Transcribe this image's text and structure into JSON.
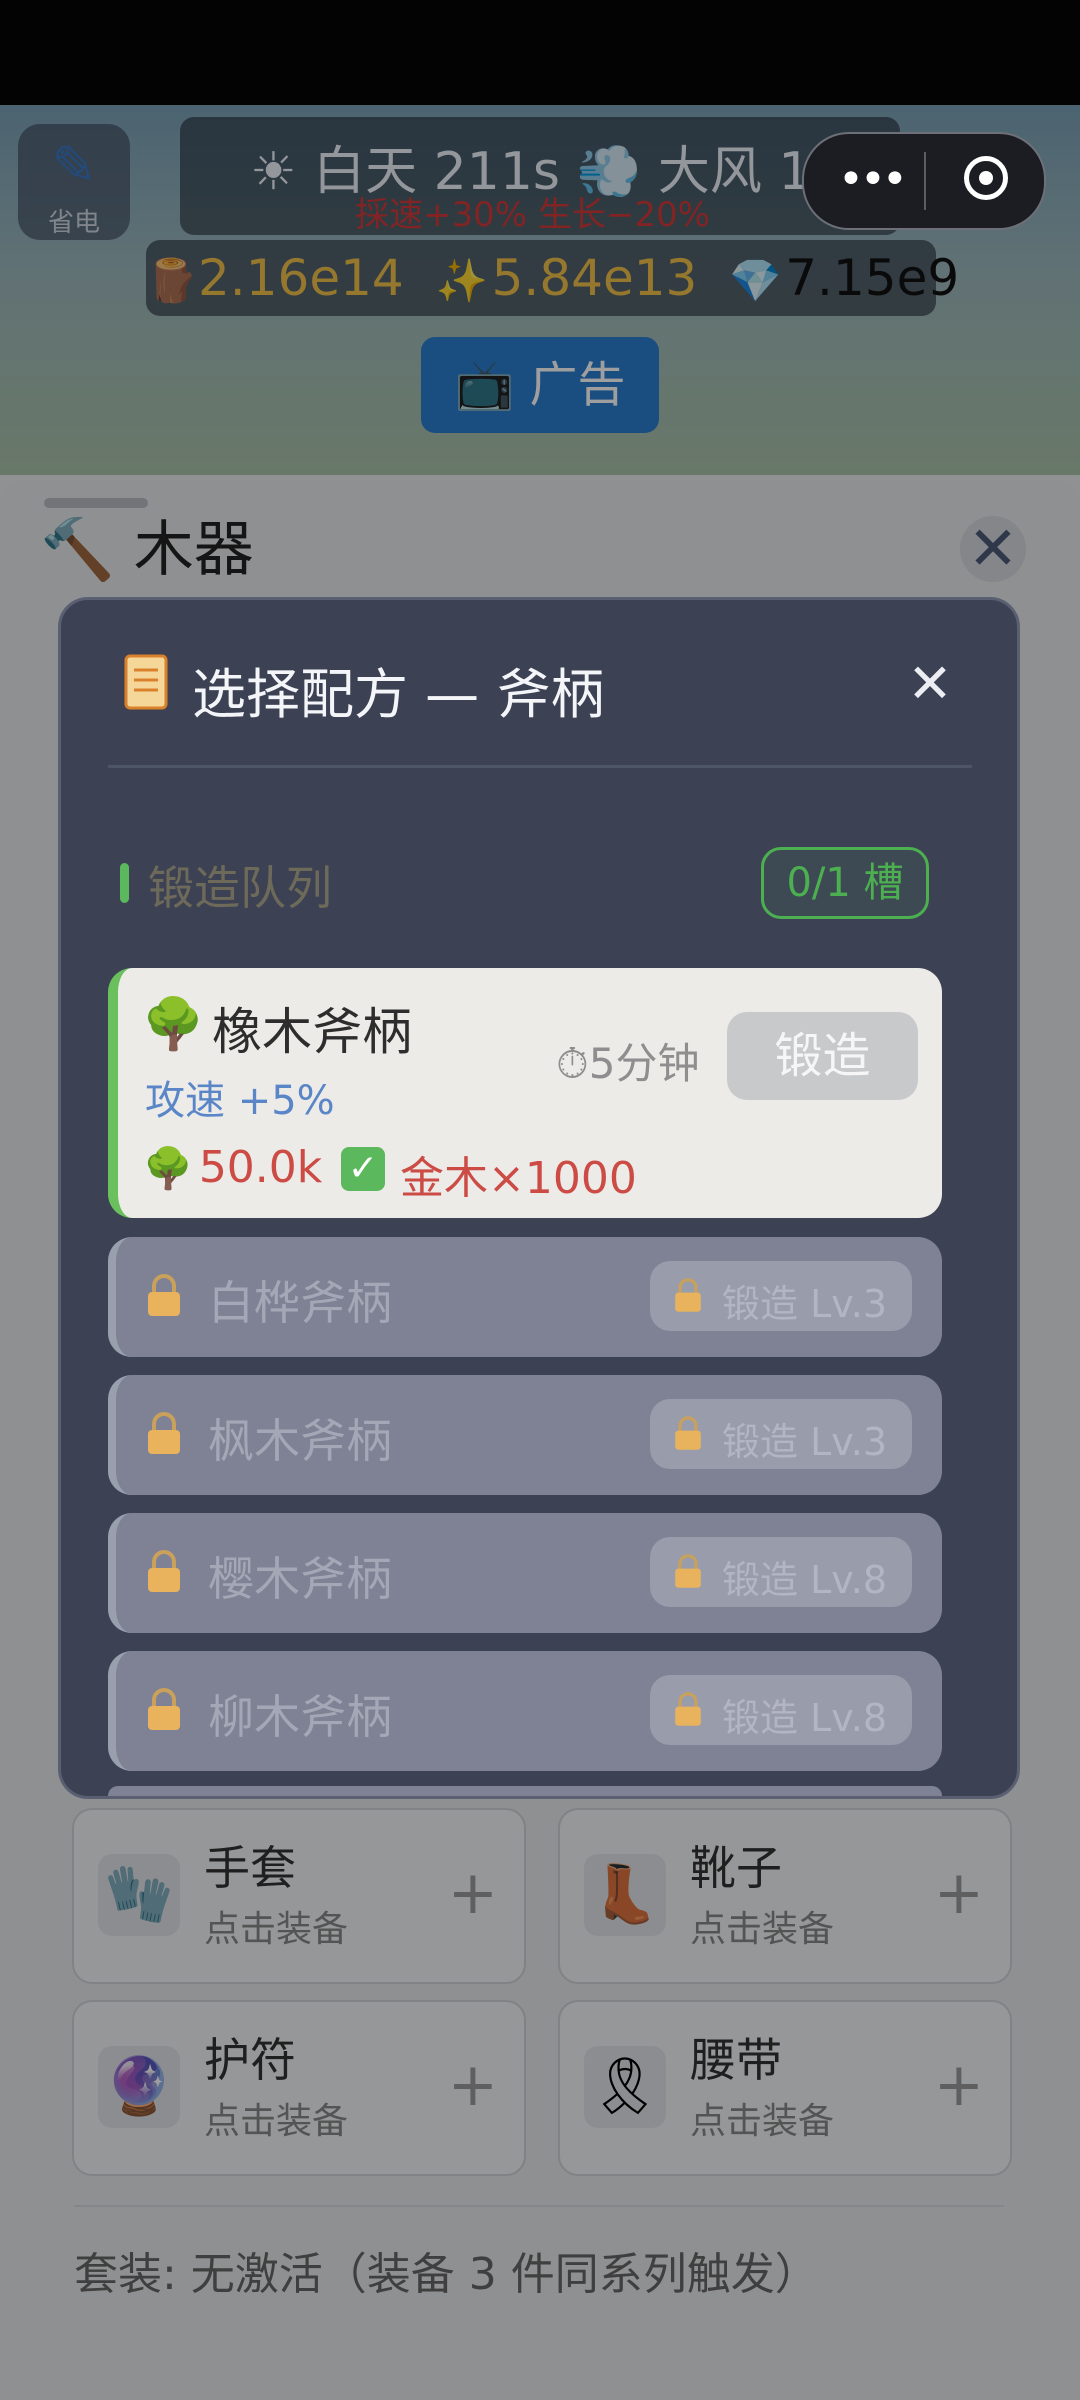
{
  "top": {
    "power_label": "省电",
    "weather_line1": "☀ 白天 211s  💨 大风 136",
    "weather_line2": "採速+30%  生长−20%",
    "resources": {
      "wood": "2.16e14",
      "spark": "5.84e13",
      "gem": "7.15e9"
    },
    "ad_label": "📺 广告"
  },
  "sheet": {
    "title": "🔨 木器",
    "close": "✕",
    "equipment": [
      {
        "name": "手套",
        "hint": "点击装备",
        "icon": "glove-icon",
        "emoji": "🧤"
      },
      {
        "name": "靴子",
        "hint": "点击装备",
        "icon": "boot-icon",
        "emoji": "👢"
      },
      {
        "name": "护符",
        "hint": "点击装备",
        "icon": "amulet-icon",
        "emoji": "🔮"
      },
      {
        "name": "腰带",
        "hint": "点击装备",
        "icon": "belt-icon",
        "emoji": "🎗"
      }
    ],
    "plus": "+",
    "set_info": "套装: 无激活（装备 3 件同系列触发）"
  },
  "modal": {
    "title": "选择配方 — 斧柄",
    "close": "✕",
    "queue_label": "锻造队列",
    "slots": "0/1 槽",
    "recipe": {
      "name": "橡木斧柄",
      "stat": "攻速 +5%",
      "time": "⏱5分钟",
      "forge_label": "锻造",
      "cost_wood": "50.0k",
      "cost_material": "金木×1000"
    },
    "locked": [
      {
        "name": "白桦斧柄",
        "req": "锻造 Lv.3"
      },
      {
        "name": "枫木斧柄",
        "req": "锻造 Lv.3"
      },
      {
        "name": "樱木斧柄",
        "req": "锻造 Lv.8"
      },
      {
        "name": "柳木斧柄",
        "req": "锻造 Lv.8"
      }
    ]
  },
  "colors": {
    "accent_green": "#4caf50",
    "cost_red": "#cc4b45",
    "stat_blue": "#5a86c8",
    "modal_bg": "#3c4254"
  }
}
